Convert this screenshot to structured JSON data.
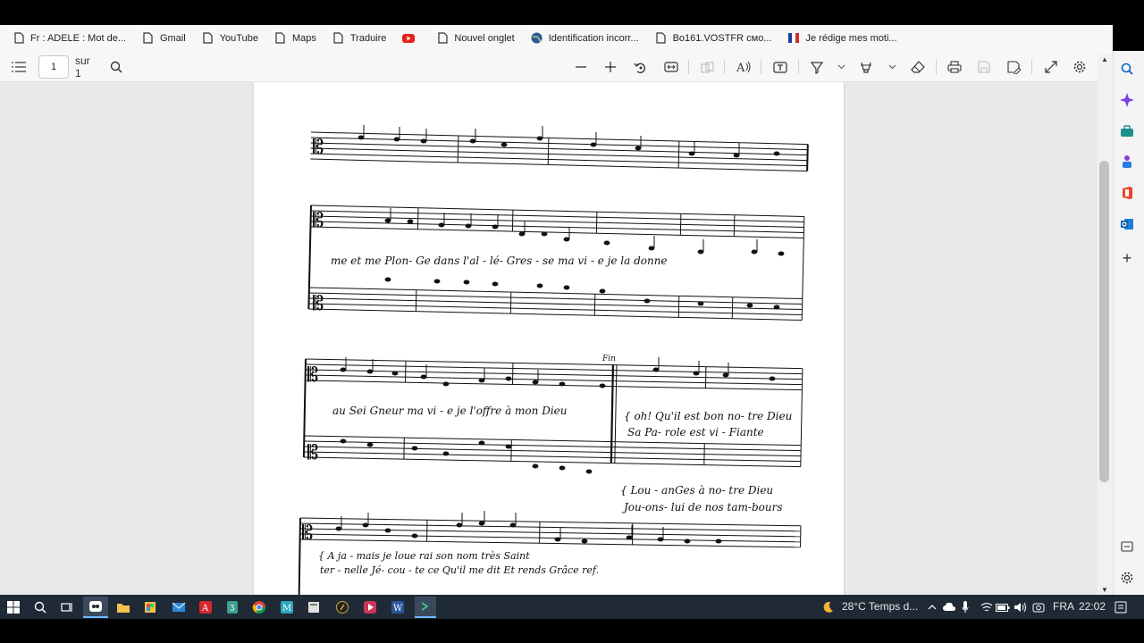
{
  "favorites": [
    {
      "label": "Fr : ADELE : Mot de...",
      "icon": "page-icon"
    },
    {
      "label": "Gmail",
      "icon": "page-icon"
    },
    {
      "label": "YouTube",
      "icon": "page-icon"
    },
    {
      "label": "Maps",
      "icon": "page-icon"
    },
    {
      "label": "Traduire",
      "icon": "page-icon"
    },
    {
      "label": "",
      "icon": "youtube-icon"
    },
    {
      "label": "Nouvel onglet",
      "icon": "page-icon"
    },
    {
      "label": "Identification incorr...",
      "icon": "globe-icon"
    },
    {
      "label": "Bo161.VOSTFR смо...",
      "icon": "page-icon"
    },
    {
      "label": "Je rédige mes moti...",
      "icon": "flag-icon"
    }
  ],
  "pdf": {
    "page_number": "1",
    "page_total": "sur 1"
  },
  "sheet": {
    "lyrics": [
      "me  et  me  Plon- Ge  dans  l'al - lé- Gres - se  ma  vi  -  e  je  la donne",
      "au  Sei Gneur  ma  vi  -  e  je  l'offre  à mon Dieu",
      "{ oh! Qu'il  est  bon  no- tre  Dieu",
      "  Sa  Pa- role  est  vi -  Fiante",
      "{ Lou -  anGes  à  no- tre  Dieu",
      "  Jou-ons- lui   de nos  tam-bours",
      "{ A  ja   -   mais   je  loue rai  son  nom  très Saint",
      "  ter -  nelle   Jé- cou -  te   ce   Qu'il  me  dit   Et  rends   Grâce  ref."
    ],
    "fin_label": "Fin"
  },
  "taskbar": {
    "weather": "28°C  Temps d...",
    "lang": "FRA",
    "time": "22:02"
  },
  "colors": {
    "accent": "#0a64c8",
    "taskbar": "#1f2a36"
  }
}
